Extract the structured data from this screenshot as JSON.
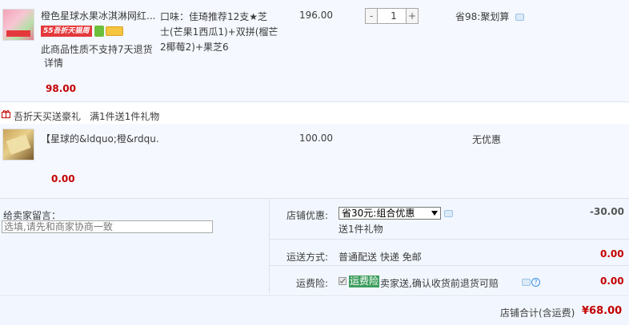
{
  "item1": {
    "title": "橙色星球水果冰淇淋网红...",
    "badge_55": "55吾折天猫周",
    "return_note": "此商品性质不支持7天退货",
    "detail_link": "详情",
    "sku_lines": [
      "口味：佳琦推荐12支★芝",
      "士(芒果1西瓜1)+双拼(榴芒",
      "2椰莓2)+果芝6"
    ],
    "price": "196.00",
    "quantity": "1",
    "minus": "-",
    "plus": "+",
    "promo": "省98:聚划算",
    "subtotal": "98.00"
  },
  "gift_header": {
    "label": "吾折天买送豪礼",
    "rule": "满1件送1件礼物"
  },
  "item2": {
    "title": "【星球的&ldquo;橙&rdqu...",
    "price": "100.00",
    "promo": "无优惠",
    "subtotal": "0.00"
  },
  "order": {
    "message_label": "给卖家留言：",
    "message_placeholder": "选填,请先和商家协商一致",
    "shop_discount_label": "店铺优惠:",
    "shop_discount_selected": "省30元:组合优惠",
    "shop_discount_amount": "-30.00",
    "gift_note": "送1件礼物",
    "shipping_label": "运送方式:",
    "shipping_value": "普通配送 快递 免邮",
    "shipping_amount": "0.00",
    "insurance_label": "运费险:",
    "insurance_highlight": "运费险",
    "insurance_desc": "卖家送,确认收货前退货可赔",
    "insurance_amount": "0.00",
    "total_label": "店铺合计(含运费)",
    "total_value": "¥68.00"
  },
  "colors": {
    "accent_red": "#c40000",
    "item_bg": "#f5f8ff",
    "insurance_green": "#3d9e5e"
  },
  "icons": [
    "chat-icon",
    "gift-icon",
    "help-icon",
    "checkbox-icon"
  ]
}
